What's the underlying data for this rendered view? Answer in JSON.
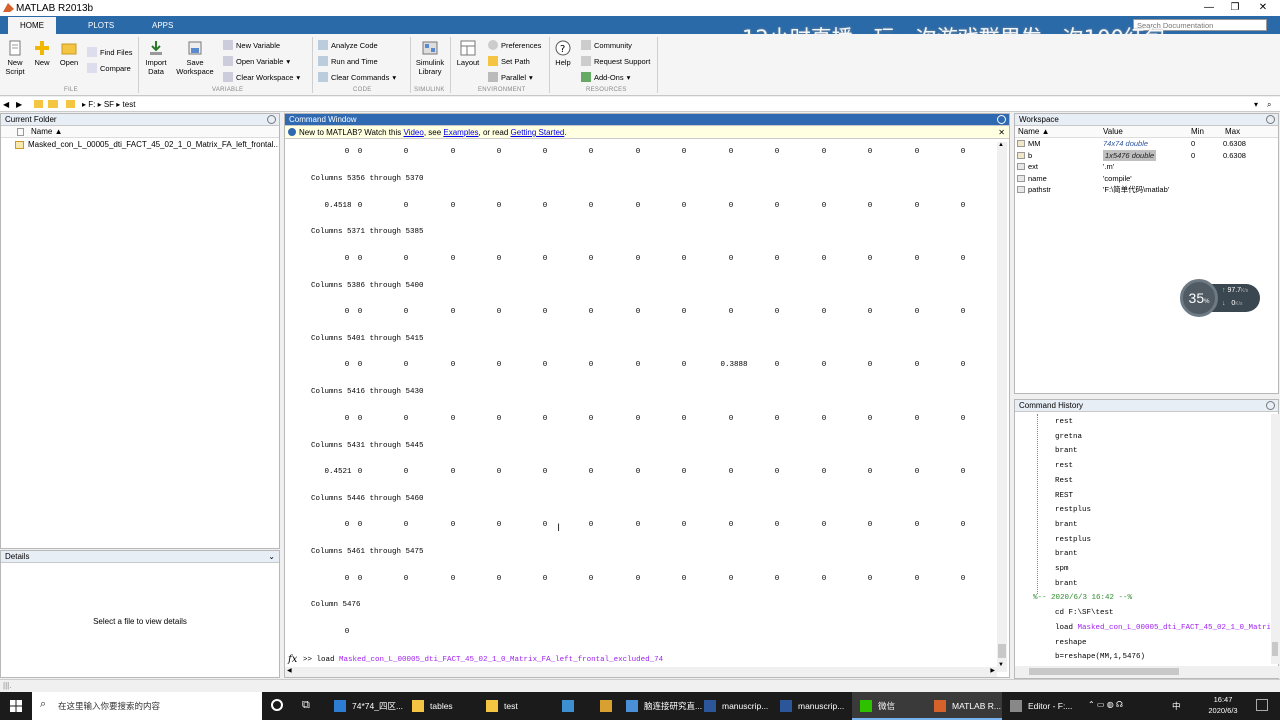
{
  "window": {
    "title": "MATLAB R2013b"
  },
  "ribbon": {
    "tabs": [
      "HOME",
      "PLOTS",
      "APPS"
    ],
    "buttons": {
      "new_script": "New\nScript",
      "new": "New",
      "open": "Open",
      "import_data": "Import\nData",
      "save_workspace": "Save\nWorkspace",
      "simulink_library": "Simulink\nLibrary",
      "layout": "Layout",
      "help": "Help"
    },
    "small": {
      "find_files": "Find Files",
      "compare": "Compare",
      "new_variable": "New Variable",
      "open_variable": "Open Variable",
      "clear_workspace": "Clear Workspace",
      "analyze_code": "Analyze Code",
      "run_and_time": "Run and Time",
      "clear_commands": "Clear Commands",
      "preferences": "Preferences",
      "set_path": "Set Path",
      "parallel": "Parallel",
      "community": "Community",
      "request_support": "Request Support",
      "add_ons": "Add-Ons"
    },
    "groups": [
      "FILE",
      "VARIABLE",
      "CODE",
      "SIMULINK",
      "ENVIRONMENT",
      "RESOURCES"
    ],
    "search_placeholder": "Search Documentation"
  },
  "overlay_text": "12小时直播，玩一次游戏群里发一次100红包",
  "address": {
    "parts": [
      "F:",
      "SF",
      "test"
    ]
  },
  "current_folder": {
    "title": "Current Folder",
    "col_name": "Name ▲",
    "files": [
      "Masked_con_L_00005_dti_FACT_45_02_1_0_Matrix_FA_left_frontal..."
    ]
  },
  "details": {
    "title": "Details",
    "placeholder": "Select a file to view details"
  },
  "command_window": {
    "title": "Command Window",
    "notice": {
      "pre": "New to MATLAB? Watch this ",
      "video": "Video",
      "mid1": ", see ",
      "examples": "Examples",
      "mid2": ", or read ",
      "gs": "Getting Started",
      "post": "."
    },
    "blocks": [
      {
        "header": "",
        "values": [
          "0",
          "0",
          "0",
          "0",
          "0",
          "0",
          "0",
          "0",
          "0",
          "0",
          "0",
          "0",
          "0",
          "0",
          "0"
        ]
      },
      {
        "header": "Columns 5356 through 5370",
        "values": [
          "0.4518",
          "0",
          "0",
          "0",
          "0",
          "0",
          "0",
          "0",
          "0",
          "0",
          "0",
          "0",
          "0",
          "0",
          "0"
        ]
      },
      {
        "header": "Columns 5371 through 5385",
        "values": [
          "0",
          "0",
          "0",
          "0",
          "0",
          "0",
          "0",
          "0",
          "0",
          "0",
          "0",
          "0",
          "0",
          "0",
          "0"
        ]
      },
      {
        "header": "Columns 5386 through 5400",
        "values": [
          "0",
          "0",
          "0",
          "0",
          "0",
          "0",
          "0",
          "0",
          "0",
          "0",
          "0",
          "0",
          "0",
          "0",
          "0"
        ]
      },
      {
        "header": "Columns 5401 through 5415",
        "values": [
          "0",
          "0",
          "0",
          "0",
          "0",
          "0",
          "0",
          "0",
          "0",
          "0.3888",
          "0",
          "0",
          "0",
          "0",
          "0"
        ]
      },
      {
        "header": "Columns 5416 through 5430",
        "values": [
          "0",
          "0",
          "0",
          "0",
          "0",
          "0",
          "0",
          "0",
          "0",
          "0",
          "0",
          "0",
          "0",
          "0",
          "0"
        ]
      },
      {
        "header": "Columns 5431 through 5445",
        "values": [
          "0.4521",
          "0",
          "0",
          "0",
          "0",
          "0",
          "0",
          "0",
          "0",
          "0",
          "0",
          "0",
          "0",
          "0",
          "0"
        ]
      },
      {
        "header": "Columns 5446 through 5460",
        "values": [
          "0",
          "0",
          "0",
          "0",
          "0",
          "0",
          "0",
          "0",
          "0",
          "0",
          "0",
          "0",
          "0",
          "0",
          "0"
        ]
      },
      {
        "header": "Columns 5461 through 5475",
        "values": [
          "0",
          "0",
          "0",
          "0",
          "0",
          "0",
          "0",
          "0",
          "0",
          "0",
          "0",
          "0",
          "0",
          "0",
          "0"
        ]
      },
      {
        "header": "Column 5476",
        "values": [
          "0"
        ]
      }
    ],
    "prompt": ">> ",
    "input_cmd": "load ",
    "input_arg": "Masked_con_L_00005_dti_FACT_45_02_1_0_Matrix_FA_left_frontal_excluded_74"
  },
  "workspace": {
    "title": "Workspace",
    "cols": [
      "Name ▲",
      "Value",
      "Min",
      "Max"
    ],
    "rows": [
      {
        "name": "MM",
        "value": "74x74 double",
        "min": "0",
        "max": "0.6308"
      },
      {
        "name": "b",
        "value": "1x5476 double",
        "min": "0",
        "max": "0.6308"
      },
      {
        "name": "ext",
        "value": "'.m'",
        "min": "",
        "max": ""
      },
      {
        "name": "name",
        "value": "'compile'",
        "min": "",
        "max": ""
      },
      {
        "name": "pathstr",
        "value": "'F:\\简单代码\\matlab'",
        "min": "",
        "max": ""
      }
    ]
  },
  "speed_widget": {
    "percent": "35",
    "up": "97.7",
    "up_unit": "K/s",
    "down": "0",
    "down_unit": "K/s"
  },
  "history": {
    "title": "Command History",
    "items": [
      "rest",
      "gretna",
      "brant",
      "rest",
      "Rest",
      "REST",
      "restplus",
      "brant",
      "restplus",
      "brant",
      "spm",
      "brant"
    ],
    "session": "%-- 2020/6/3 16:42 --%",
    "session_items": [
      "cd F:\\SF\\test",
      "load Masked_con_L_00005_dti_FACT_45_02_1_0_Matrix",
      "reshape",
      "b=reshape(MM,1,5476)"
    ]
  },
  "taskbar": {
    "search_placeholder": "在这里输入你要搜索的内容",
    "items": [
      "74*74_四区...",
      "tables",
      "test",
      "",
      "",
      "脑连接研究直...",
      "manuscrip...",
      "manuscrip...",
      "微信",
      "MATLAB R...",
      "Editor - F:..."
    ],
    "time": "16:47",
    "date": "2020/6/3",
    "ime": "中"
  },
  "colors": {
    "accent": "#2e69b1",
    "taskbar": "#1b1b1b"
  }
}
